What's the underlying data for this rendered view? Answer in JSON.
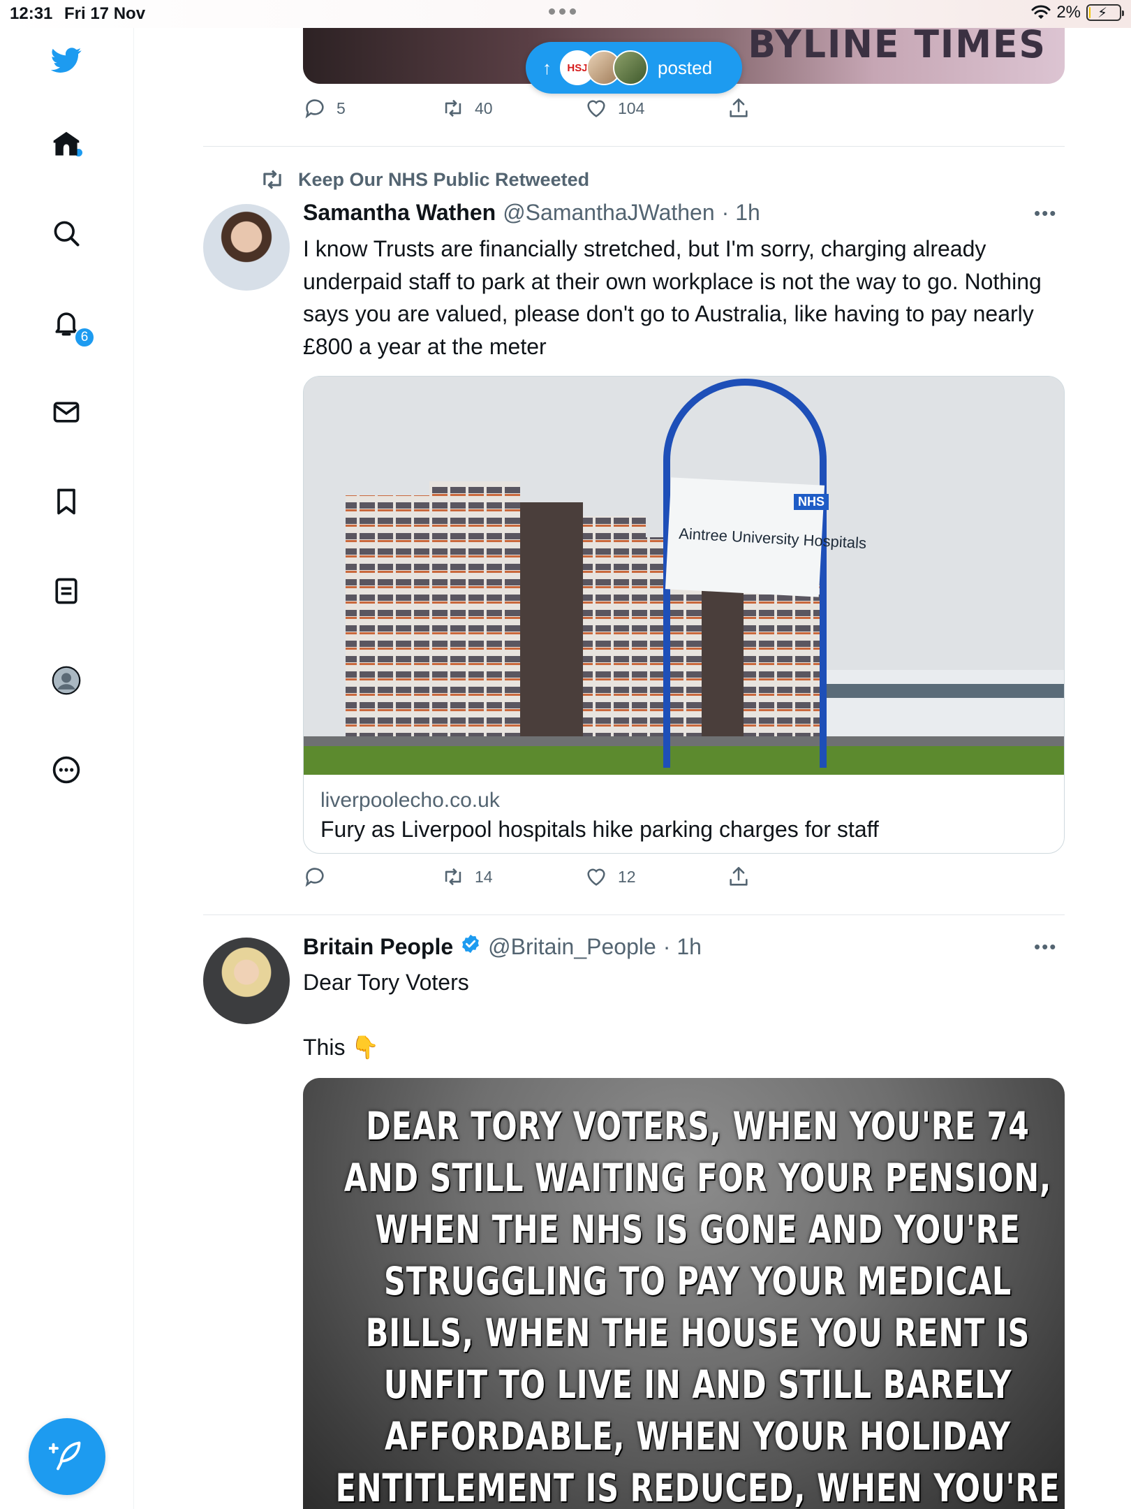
{
  "status_bar": {
    "time": "12:31",
    "date": "Fri 17 Nov",
    "battery": "2%",
    "battery_level": 0.02
  },
  "sidebar": {
    "notifications_badge": "6",
    "items": [
      {
        "icon": "twitter-bird-icon"
      },
      {
        "icon": "home-icon"
      },
      {
        "icon": "search-icon"
      },
      {
        "icon": "bell-icon"
      },
      {
        "icon": "mail-icon"
      },
      {
        "icon": "bookmark-icon"
      },
      {
        "icon": "lists-icon"
      },
      {
        "icon": "profile-icon"
      },
      {
        "icon": "more-circle-icon"
      }
    ],
    "compose_icon": "compose-feather-icon"
  },
  "new_posts_pill": {
    "label": "posted",
    "avatar_1": "HSJ"
  },
  "previous_tweet": {
    "card_image_text": "BYLINE TIMES",
    "replies": "5",
    "retweets": "40",
    "likes": "104"
  },
  "tweet_1": {
    "retweeted_by": "Keep Our NHS Public Retweeted",
    "name": "Samantha Wathen",
    "handle": "@SamanthaJWathen",
    "time": "· 1h",
    "text": "I know Trusts are financially stretched, but I'm sorry, charging already underpaid staff to park at their own workplace is not the way to go. Nothing says you are valued, please don't go to Australia, like having to pay nearly £800 a year at the meter",
    "link_card": {
      "sign_nhs": "NHS",
      "sign_text": "Aintree University Hospitals",
      "domain": "liverpoolecho.co.uk",
      "title": "Fury as Liverpool hospitals hike parking charges for staff"
    },
    "replies": "",
    "retweets": "14",
    "likes": "12"
  },
  "tweet_2": {
    "name": "Britain People",
    "handle": "@Britain_People",
    "time": "· 1h",
    "text_line_1": "Dear Tory Voters",
    "text_line_2": "This 👇",
    "meme_text": "DEAR TORY VOTERS, WHEN YOU'RE 74 AND STILL WAITING FOR YOUR PENSION, WHEN THE NHS IS GONE AND YOU'RE STRUGGLING TO PAY YOUR MEDICAL BILLS, WHEN THE HOUSE YOU RENT IS UNFIT TO LIVE IN AND STILL BARELY AFFORDABLE, WHEN YOUR HOLIDAY ENTITLEMENT IS REDUCED, WHEN YOU'RE FORCED INTO A ZERO-HOURS CONTRACT,"
  },
  "colors": {
    "accent": "#1d9bf0",
    "text_primary": "#0f1419",
    "text_secondary": "#536471",
    "divider": "#e3e7ea"
  }
}
